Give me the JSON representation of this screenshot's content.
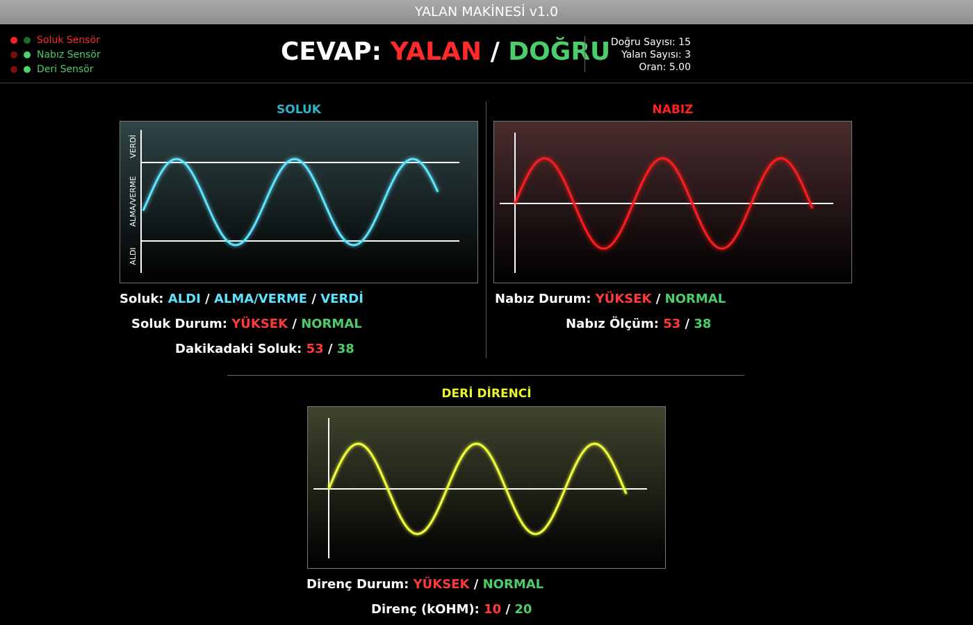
{
  "window": {
    "title": "YALAN MAKİNESİ v1.0"
  },
  "colors": {
    "red": "#ff2a2a",
    "green": "#4ccc6a",
    "cyan": "#5ee3ff",
    "yellow": "#f0ff3a"
  },
  "sensors": [
    {
      "label": "Soluk Sensör",
      "dot1": "#ff2020",
      "dot2": "#1e6b2a",
      "label_color": "#ff2a2a"
    },
    {
      "label": "Nabız Sensör",
      "dot1": "#7a1010",
      "dot2": "#4cd36a",
      "label_color": "#4ccc6a"
    },
    {
      "label": "Deri Sensör",
      "dot1": "#7a1010",
      "dot2": "#4cd36a",
      "label_color": "#4ccc6a"
    }
  ],
  "answer": {
    "prefix": "CEVAP:",
    "lie": "YALAN",
    "sep": "/",
    "truth": "DOĞRU"
  },
  "stats": {
    "truth_count": "Doğru Sayısı: 15",
    "lie_count": "Yalan Sayısı: 3",
    "ratio": "Oran: 5.00"
  },
  "soluk": {
    "title": "SOLUK",
    "axis_labels": {
      "top": "VERDİ",
      "middle": "ALMA/VERME",
      "bottom": "ALDI"
    },
    "line1": {
      "label": "Soluk:",
      "v1": "ALDI",
      "v2": "ALMA/VERME",
      "v3": "VERDİ",
      "sep": "/"
    },
    "line2": {
      "label": "Soluk Durum:",
      "high": "YÜKSEK",
      "normal": "NORMAL",
      "sep": "/"
    },
    "line3": {
      "label": "Dakikadaki Soluk:",
      "v1": "53",
      "v2": "38",
      "sep": "/"
    }
  },
  "nabiz": {
    "title": "NABIZ",
    "line1": {
      "label": "Nabız Durum:",
      "high": "YÜKSEK",
      "normal": "NORMAL",
      "sep": "/"
    },
    "line2": {
      "label": "Nabız Ölçüm:",
      "v1": "53",
      "v2": "38",
      "sep": "/"
    }
  },
  "deri": {
    "title": "DERİ DİRENCİ",
    "line1": {
      "label": "Direnç Durum:",
      "high": "YÜKSEK",
      "normal": "NORMAL",
      "sep": "/"
    },
    "line2": {
      "label": "Direnç (kOHM):",
      "v1": "10",
      "v2": "20",
      "sep": "/"
    }
  }
}
